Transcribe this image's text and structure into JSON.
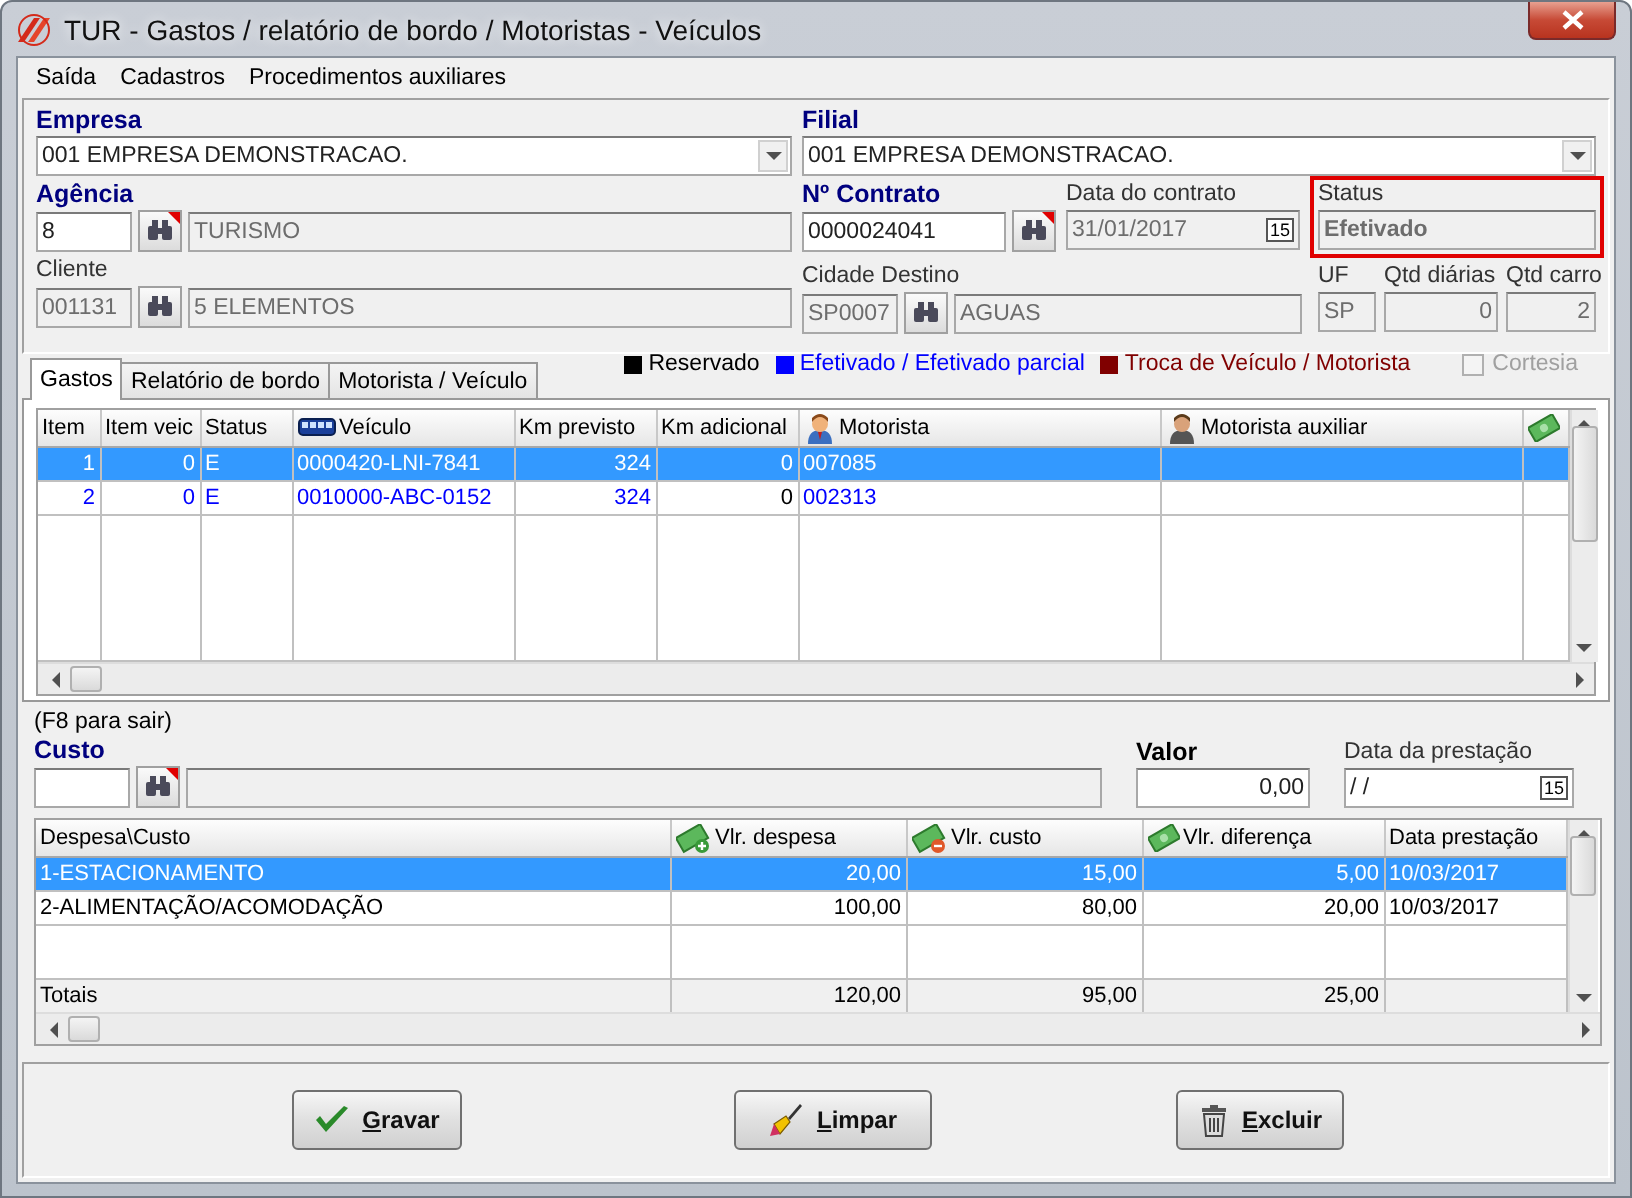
{
  "window": {
    "title": "TUR - Gastos / relatório de bordo / Motoristas - Veículos"
  },
  "menu": [
    "Saída",
    "Cadastros",
    "Procedimentos auxiliares"
  ],
  "empresa": {
    "label": "Empresa",
    "value": "001 EMPRESA DEMONSTRACAO."
  },
  "filial": {
    "label": "Filial",
    "value": "001 EMPRESA DEMONSTRACAO."
  },
  "agencia": {
    "label": "Agência",
    "code": "8",
    "code_disabled": false,
    "name": "TURISMO",
    "required": true
  },
  "contrato": {
    "label": "Nº Contrato",
    "code": "0000024041",
    "code_disabled": false,
    "required": true
  },
  "data_contrato": {
    "label": "Data do contrato",
    "value": "31/01/2017",
    "calendar": "15"
  },
  "status": {
    "label": "Status",
    "value": "Efetivado",
    "highlighted": true
  },
  "cliente": {
    "label": "Cliente",
    "code": "001131",
    "code_disabled": true,
    "name": "5 ELEMENTOS",
    "required": false
  },
  "cidade": {
    "label": "Cidade Destino",
    "code": "SP0007",
    "code_disabled": true,
    "name": "AGUAS",
    "required": false
  },
  "uf": {
    "label": "UF",
    "value": "SP"
  },
  "qtd_diarias": {
    "label": "Qtd diárias",
    "value": "0"
  },
  "qtd_carro": {
    "label": "Qtd carro",
    "value": "2"
  },
  "legend": [
    {
      "label": "Reservado",
      "color": "#000000"
    },
    {
      "label": "Efetivado / Efetivado parcial",
      "color": "#0000ff"
    },
    {
      "label": "Troca de Veículo / Motorista",
      "color": "#800000"
    }
  ],
  "cortesia": {
    "label": "Cortesia",
    "checked": false,
    "disabled": true
  },
  "tabs": [
    {
      "label": "Gastos",
      "selected": true
    },
    {
      "label": "Relatório de bordo",
      "selected": false
    },
    {
      "label": "Motorista / Veículo",
      "selected": false
    }
  ],
  "vehicles": {
    "columns": [
      "Item",
      "Item veic",
      "Status",
      "Veículo",
      "Km previsto",
      "Km adicional",
      "Motorista",
      "Motorista auxiliar"
    ],
    "rows": [
      {
        "selected": true,
        "cells": [
          "1",
          "0",
          "E",
          "0000420-LNI-7841",
          "324",
          "0",
          "007085"
        ]
      },
      {
        "selected": false,
        "color": "#0000ff",
        "cells": [
          "2",
          "0",
          "E",
          "0010000-ABC-0152",
          "324",
          "0",
          "002313"
        ]
      }
    ]
  },
  "custo": {
    "hint": "(F8 para sair)",
    "label": "Custo",
    "required": true,
    "valor_label": "Valor",
    "valor": "0,00",
    "data_label": "Data da prestação",
    "data": " / /",
    "calendar": "15"
  },
  "expenses": {
    "columns": [
      "Despesa\\Custo",
      "Vlr. despesa",
      "Vlr. custo",
      "Vlr. diferença",
      "Data prestação"
    ],
    "rows": [
      {
        "selected": true,
        "cells": [
          "1-ESTACIONAMENTO",
          "20,00",
          "15,00",
          "5,00",
          "10/03/2017"
        ]
      },
      {
        "selected": false,
        "cells": [
          "2-ALIMENTAÇÃO/ACOMODAÇÃO",
          "100,00",
          "80,00",
          "20,00",
          "10/03/2017"
        ]
      }
    ],
    "totals": [
      "Totais",
      "120,00",
      "95,00",
      "25,00"
    ]
  },
  "buttons": [
    "Gravar",
    "Limpar",
    "Excluir"
  ]
}
